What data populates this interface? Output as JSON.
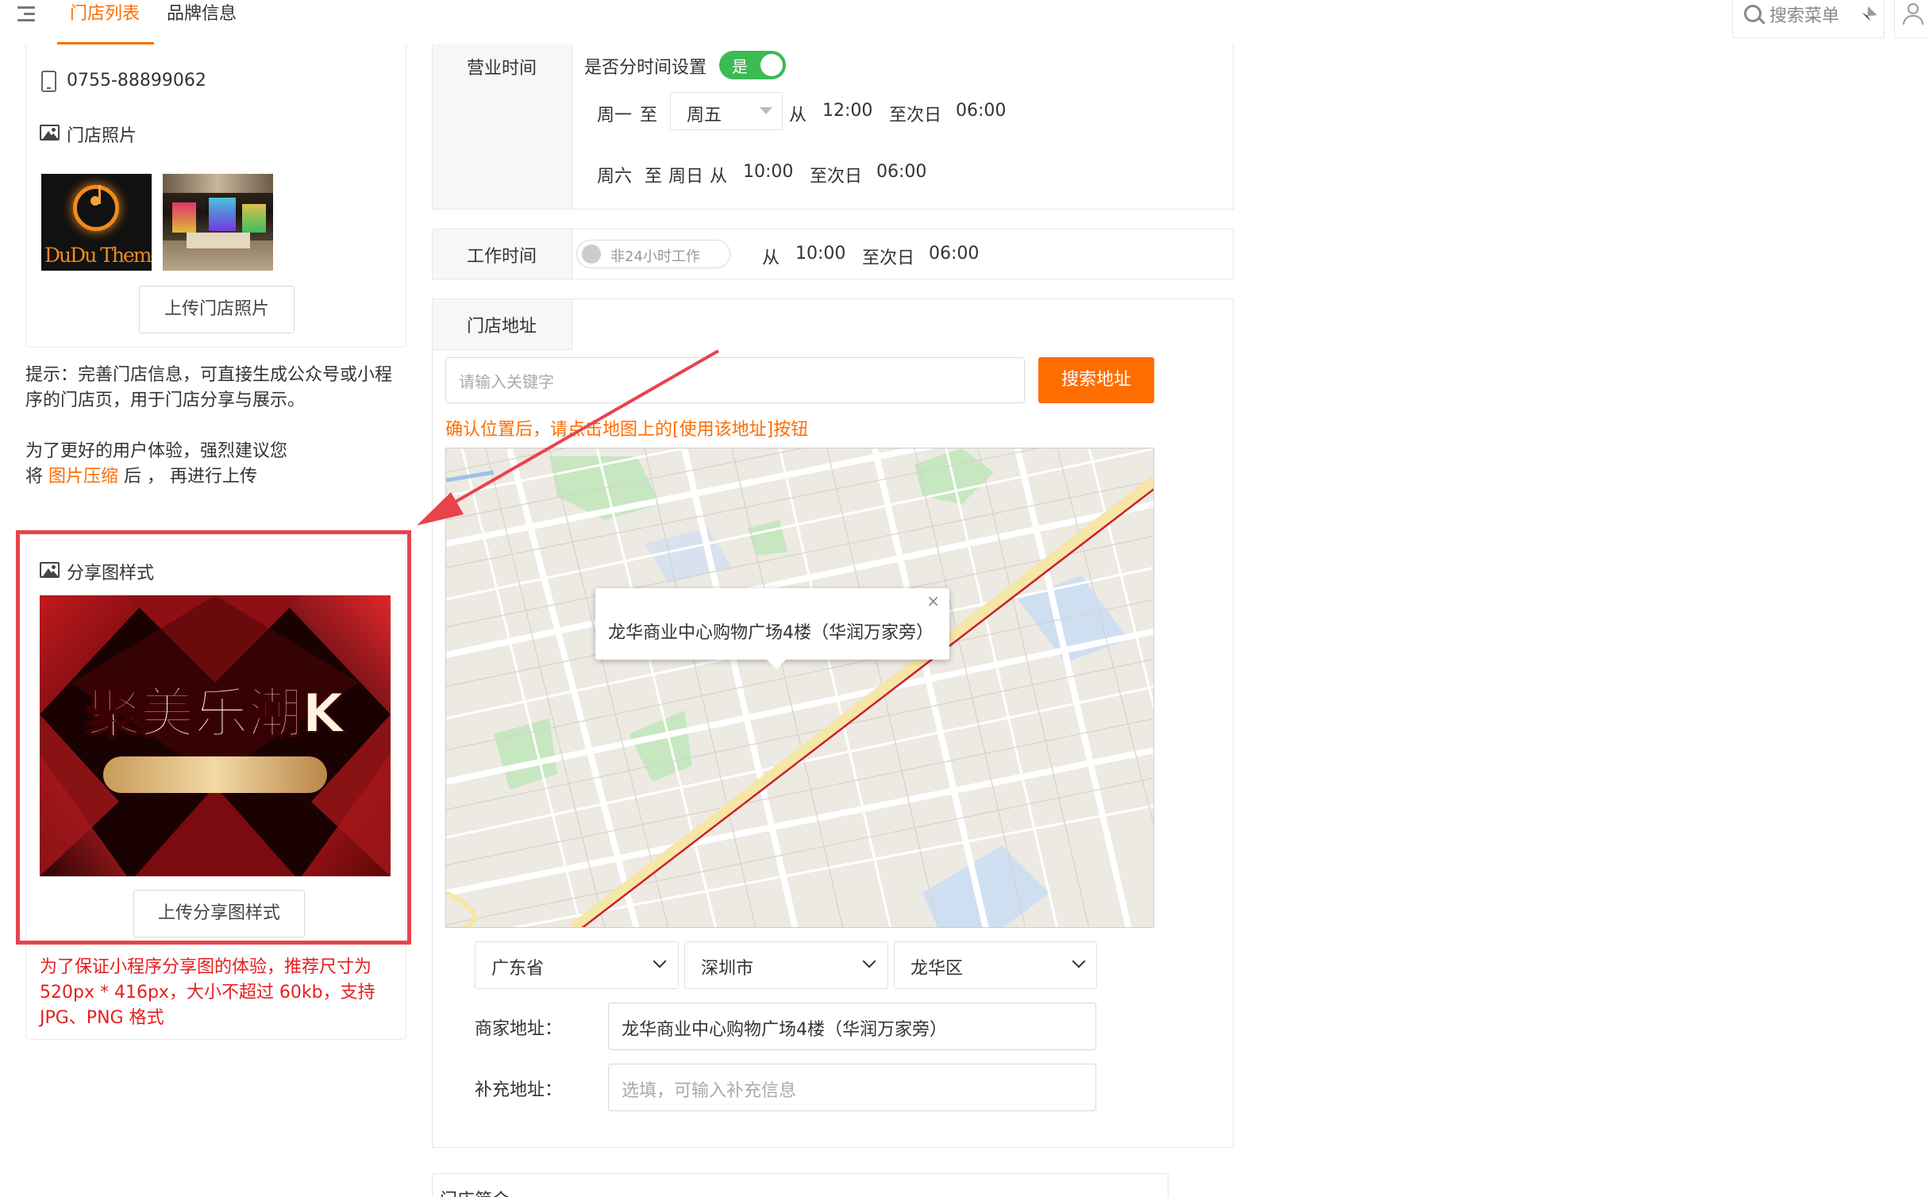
{
  "header": {
    "tabs": [
      {
        "label": "门店列表",
        "active": true
      },
      {
        "label": "品牌信息",
        "active": false
      }
    ],
    "search_menu_label": "搜索菜单"
  },
  "left": {
    "phone": "0755-88899062",
    "photos_title": "门店照片",
    "photo1_logo_text": "DuDu Theme",
    "upload_photos_button": "上传门店照片",
    "tip_line1": "提示：完善门店信息，可直接生成公众号或小程",
    "tip_line2": "序的门店页，用于门店分享与展示。",
    "ux_line1": "为了更好的用户体验，强烈建议您",
    "ux_prefix": "将",
    "ux_link": "图片压缩",
    "ux_suffix": "后 ， 再进行上传",
    "share_title": "分享图样式",
    "poster_text": "聚美乐潮K",
    "upload_share_button": "上传分享图样式",
    "share_note_line1": "为了保证小程序分享图的体验，推荐尺寸为",
    "share_note_line2": "520px * 416px，大小不超过 60kb，支持",
    "share_note_line3": "JPG、PNG 格式"
  },
  "business_hours": {
    "label": "营业时间",
    "split_question": "是否分时间设置",
    "split_toggle": {
      "on": true,
      "label": "是"
    },
    "row1": {
      "from_day": "周一",
      "to_word": "至",
      "to_day_select": "周五",
      "from_word": "从",
      "start": "12:00",
      "next_day_word": "至次日",
      "end": "06:00"
    },
    "row2": {
      "from_day": "周六",
      "to_word": "至",
      "to_day": "周日",
      "from_word": "从",
      "start": "10:00",
      "next_day_word": "至次日",
      "end": "06:00"
    }
  },
  "work_hours": {
    "label": "工作时间",
    "toggle": {
      "on": false,
      "label": "非24小时工作"
    },
    "from_word": "从",
    "start": "10:00",
    "next_day_word": "至次日",
    "end": "06:00"
  },
  "address": {
    "label": "门店地址",
    "keyword_placeholder": "请输入关键字",
    "search_button": "搜索地址",
    "confirm_hint": "确认位置后，请点击地图上的[使用该地址]按钮",
    "map_popup_text": "龙华商业中心购物广场4楼（华润万家旁）",
    "map_popup_close": "×",
    "province": "广东省",
    "city": "深圳市",
    "district": "龙华区",
    "merchant_address_label": "商家地址：",
    "merchant_address_value": "龙华商业中心购物广场4楼（华润万家旁）",
    "extra_address_label": "补充地址：",
    "extra_address_placeholder": "选填，可输入补充信息"
  },
  "intro": {
    "label": "门店简介"
  },
  "colors": {
    "accent": "#ff6d00",
    "warning_red": "#e61e1e",
    "toggle_green": "#3cba54",
    "highlight_box": "#e8434b"
  }
}
